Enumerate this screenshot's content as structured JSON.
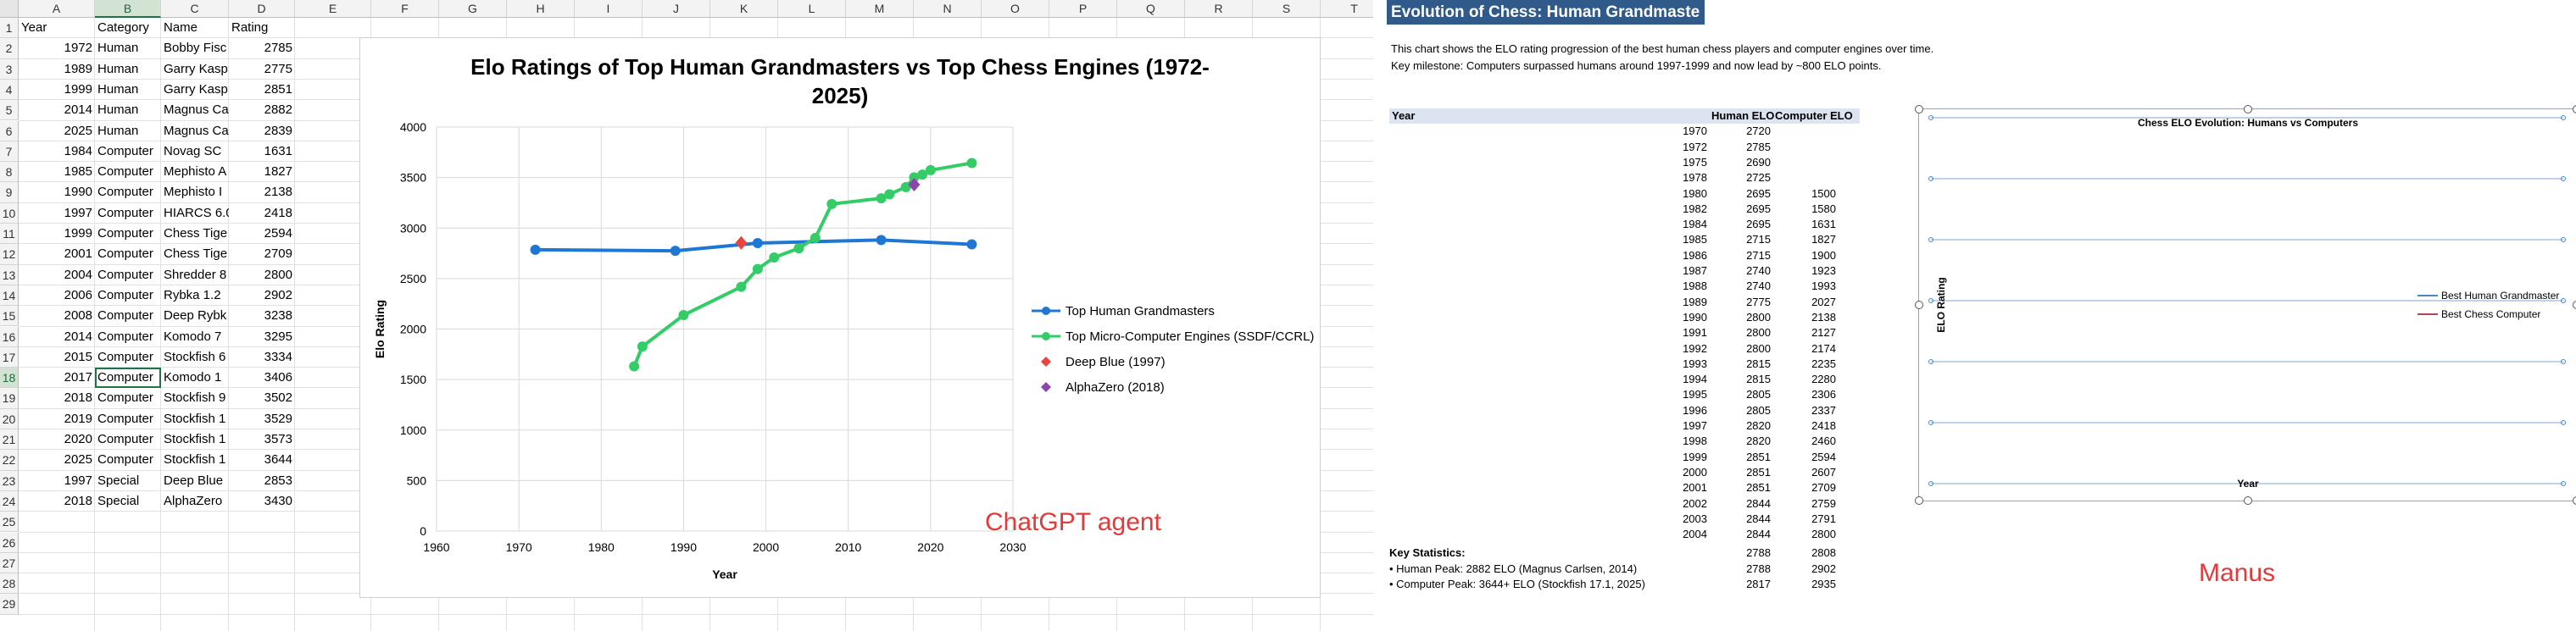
{
  "sheet": {
    "columns": [
      "A",
      "B",
      "C",
      "D",
      "E",
      "F",
      "G",
      "H",
      "I",
      "J",
      "K",
      "L",
      "M",
      "N",
      "O",
      "P",
      "Q",
      "R",
      "S",
      "T"
    ],
    "selected_column": "B",
    "selected_row": "18",
    "row_numbers": [
      "1",
      "2",
      "3",
      "4",
      "5",
      "6",
      "7",
      "8",
      "9",
      "10",
      "11",
      "12",
      "13",
      "14",
      "15",
      "16",
      "17",
      "18",
      "19",
      "20",
      "21",
      "22",
      "23",
      "24",
      "25",
      "26",
      "27",
      "28",
      "29"
    ],
    "header": {
      "year": "Year",
      "category": "Category",
      "name": "Name",
      "rating": "Rating"
    },
    "rows": [
      {
        "year": "1972",
        "category": "Human",
        "name": "Bobby Fisc",
        "rating": "2785"
      },
      {
        "year": "1989",
        "category": "Human",
        "name": "Garry Kasp",
        "rating": "2775"
      },
      {
        "year": "1999",
        "category": "Human",
        "name": "Garry Kasp",
        "rating": "2851"
      },
      {
        "year": "2014",
        "category": "Human",
        "name": "Magnus Ca",
        "rating": "2882"
      },
      {
        "year": "2025",
        "category": "Human",
        "name": "Magnus Ca",
        "rating": "2839"
      },
      {
        "year": "1984",
        "category": "Computer",
        "name": "Novag SC",
        "rating": "1631"
      },
      {
        "year": "1985",
        "category": "Computer",
        "name": "Mephisto A",
        "rating": "1827"
      },
      {
        "year": "1990",
        "category": "Computer",
        "name": "Mephisto I",
        "rating": "2138"
      },
      {
        "year": "1997",
        "category": "Computer",
        "name": "HIARCS 6.0",
        "rating": "2418"
      },
      {
        "year": "1999",
        "category": "Computer",
        "name": "Chess Tige",
        "rating": "2594"
      },
      {
        "year": "2001",
        "category": "Computer",
        "name": "Chess Tige",
        "rating": "2709"
      },
      {
        "year": "2004",
        "category": "Computer",
        "name": "Shredder 8",
        "rating": "2800"
      },
      {
        "year": "2006",
        "category": "Computer",
        "name": "Rybka 1.2",
        "rating": "2902"
      },
      {
        "year": "2008",
        "category": "Computer",
        "name": "Deep Rybk",
        "rating": "3238"
      },
      {
        "year": "2014",
        "category": "Computer",
        "name": "Komodo 7",
        "rating": "3295"
      },
      {
        "year": "2015",
        "category": "Computer",
        "name": "Stockfish 6",
        "rating": "3334"
      },
      {
        "year": "2017",
        "category": "Computer",
        "name": "Komodo 1",
        "rating": "3406"
      },
      {
        "year": "2018",
        "category": "Computer",
        "name": "Stockfish 9",
        "rating": "3502"
      },
      {
        "year": "2019",
        "category": "Computer",
        "name": "Stockfish 1",
        "rating": "3529"
      },
      {
        "year": "2020",
        "category": "Computer",
        "name": "Stockfish 1",
        "rating": "3573"
      },
      {
        "year": "2025",
        "category": "Computer",
        "name": "Stockfish 1",
        "rating": "3644"
      },
      {
        "year": "1997",
        "category": "Special",
        "name": "Deep Blue",
        "rating": "2853"
      },
      {
        "year": "2018",
        "category": "Special",
        "name": "AlphaZero",
        "rating": "3430"
      }
    ]
  },
  "chart_data": [
    {
      "type": "line",
      "title": "Elo Ratings of Top Human Grandmasters vs Top Chess Engines (1972-2025)",
      "xlabel": "Year",
      "ylabel": "Elo Rating",
      "xlim": [
        1960,
        2030
      ],
      "ylim": [
        0,
        4000
      ],
      "xticks": [
        "1960",
        "1970",
        "1980",
        "1990",
        "2000",
        "2010",
        "2020",
        "2030"
      ],
      "yticks": [
        "0",
        "500",
        "1000",
        "1500",
        "2000",
        "2500",
        "3000",
        "3500",
        "4000"
      ],
      "grid": true,
      "legend": "right",
      "series": [
        {
          "name": "Top Human Grandmasters",
          "color": "#1f77d4",
          "marker": "circle",
          "points": [
            [
              1972,
              2785
            ],
            [
              1989,
              2775
            ],
            [
              1999,
              2851
            ],
            [
              2014,
              2882
            ],
            [
              2025,
              2839
            ]
          ]
        },
        {
          "name": "Top Micro-Computer Engines (SSDF/CCRL)",
          "color": "#33cc66",
          "marker": "circle",
          "points": [
            [
              1984,
              1631
            ],
            [
              1985,
              1827
            ],
            [
              1990,
              2138
            ],
            [
              1997,
              2418
            ],
            [
              1999,
              2594
            ],
            [
              2001,
              2709
            ],
            [
              2004,
              2800
            ],
            [
              2006,
              2902
            ],
            [
              2008,
              3238
            ],
            [
              2014,
              3295
            ],
            [
              2015,
              3334
            ],
            [
              2017,
              3406
            ],
            [
              2018,
              3502
            ],
            [
              2019,
              3529
            ],
            [
              2020,
              3573
            ],
            [
              2025,
              3644
            ]
          ]
        },
        {
          "name": "Deep Blue (1997)",
          "color": "#e8453c",
          "marker": "diamond",
          "points": [
            [
              1997,
              2853
            ]
          ]
        },
        {
          "name": "AlphaZero (2018)",
          "color": "#8e44ad",
          "marker": "diamond",
          "points": [
            [
              2018,
              3430
            ]
          ]
        }
      ]
    },
    {
      "type": "line",
      "title": "Chess ELO Evolution: Humans vs Computers",
      "xlabel": "Year",
      "ylabel": "ELO Rating",
      "legend": "right",
      "series": [
        {
          "name": "Best Human Grandmaster",
          "color": "#4a86c8",
          "values": []
        },
        {
          "name": "Best Chess Computer",
          "color": "#b3445c",
          "values": []
        }
      ]
    }
  ],
  "watermarks": {
    "left": "ChatGPT agent",
    "right": "Manus",
    "left_color": "#e03a3a",
    "right_color": "#e03a3a"
  },
  "right": {
    "title": "Evolution of Chess: Human Grandmaste",
    "description": "This chart shows the ELO rating progression of the best human chess players and computer engines over time.",
    "milestone": "Key milestone: Computers surpassed humans around 1997-1999 and now lead by ~800 ELO points.",
    "table_header": {
      "year": "Year",
      "human": "Human ELO",
      "computer": "Computer ELO"
    },
    "table_rows": [
      {
        "year": "1970",
        "human": "2720",
        "computer": ""
      },
      {
        "year": "1972",
        "human": "2785",
        "computer": ""
      },
      {
        "year": "1975",
        "human": "2690",
        "computer": ""
      },
      {
        "year": "1978",
        "human": "2725",
        "computer": ""
      },
      {
        "year": "1980",
        "human": "2695",
        "computer": "1500"
      },
      {
        "year": "1982",
        "human": "2695",
        "computer": "1580"
      },
      {
        "year": "1984",
        "human": "2695",
        "computer": "1631"
      },
      {
        "year": "1985",
        "human": "2715",
        "computer": "1827"
      },
      {
        "year": "1986",
        "human": "2715",
        "computer": "1900"
      },
      {
        "year": "1987",
        "human": "2740",
        "computer": "1923"
      },
      {
        "year": "1988",
        "human": "2740",
        "computer": "1993"
      },
      {
        "year": "1989",
        "human": "2775",
        "computer": "2027"
      },
      {
        "year": "1990",
        "human": "2800",
        "computer": "2138"
      },
      {
        "year": "1991",
        "human": "2800",
        "computer": "2127"
      },
      {
        "year": "1992",
        "human": "2800",
        "computer": "2174"
      },
      {
        "year": "1993",
        "human": "2815",
        "computer": "2235"
      },
      {
        "year": "1994",
        "human": "2815",
        "computer": "2280"
      },
      {
        "year": "1995",
        "human": "2805",
        "computer": "2306"
      },
      {
        "year": "1996",
        "human": "2805",
        "computer": "2337"
      },
      {
        "year": "1997",
        "human": "2820",
        "computer": "2418"
      },
      {
        "year": "1998",
        "human": "2820",
        "computer": "2460"
      },
      {
        "year": "1999",
        "human": "2851",
        "computer": "2594"
      },
      {
        "year": "2000",
        "human": "2851",
        "computer": "2607"
      },
      {
        "year": "2001",
        "human": "2851",
        "computer": "2709"
      },
      {
        "year": "2002",
        "human": "2844",
        "computer": "2759"
      },
      {
        "year": "2003",
        "human": "2844",
        "computer": "2791"
      },
      {
        "year": "2004",
        "human": "2844",
        "computer": "2800"
      }
    ],
    "key_stats_label": "Key Statistics:",
    "stats": [
      {
        "text": "• Human Peak: 2882 ELO (Magnus Carlsen, 2014)",
        "human": "2788",
        "computer": "2808"
      },
      {
        "text": "• Computer Peak: 3644+ ELO (Stockfish 17.1, 2025)",
        "human": "2788",
        "computer": "2902"
      },
      {
        "text": "",
        "human": "2817",
        "computer": "2935"
      }
    ]
  }
}
